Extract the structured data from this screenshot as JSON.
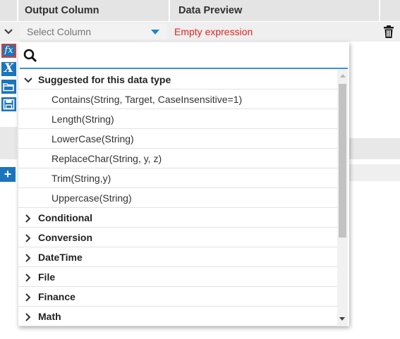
{
  "grid": {
    "headers": [
      "Output Column",
      "Data Preview"
    ],
    "row": {
      "select_placeholder": "Select Column",
      "preview_text": "Empty expression"
    }
  },
  "tools": {
    "fx_label": "fx",
    "variable_label": "X",
    "add_label": "+"
  },
  "popup": {
    "search_value": "",
    "groups": [
      {
        "label": "Suggested for this data type",
        "expanded": true,
        "items": [
          "Contains(String, Target, CaseInsensitive=1)",
          "Length(String)",
          "LowerCase(String)",
          "ReplaceChar(String, y, z)",
          "Trim(String,y)",
          "Uppercase(String)"
        ]
      },
      {
        "label": "Conditional",
        "expanded": false
      },
      {
        "label": "Conversion",
        "expanded": false
      },
      {
        "label": "DateTime",
        "expanded": false
      },
      {
        "label": "File",
        "expanded": false
      },
      {
        "label": "Finance",
        "expanded": false
      },
      {
        "label": "Math",
        "expanded": false
      }
    ]
  },
  "colors": {
    "accent": "#1c75bc",
    "error": "#e0241f",
    "focus_border": "#e23b2e",
    "search_underline": "#3d8fd6"
  },
  "icons": {
    "expander": "chevron-down-icon",
    "dropdown": "caret-down-icon",
    "delete": "trash-icon",
    "search": "search-icon",
    "group_expanded": "chevron-down-icon",
    "group_collapsed": "chevron-right-icon"
  }
}
